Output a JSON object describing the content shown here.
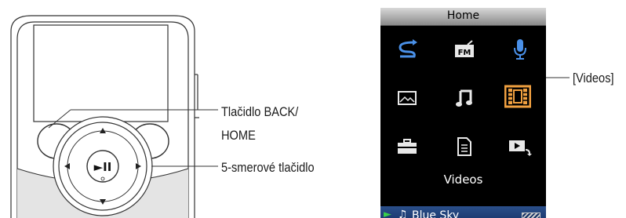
{
  "callouts": {
    "back_home_line1": "Tlačidlo BACK/",
    "back_home_line2": "HOME",
    "five_way": "5-smerové tlačidlo",
    "videos": "[Videos]"
  },
  "player_buttons": {
    "play_pause": "►II"
  },
  "screen": {
    "title": "Home",
    "icons": [
      {
        "name": "shuffle-icon",
        "text": ""
      },
      {
        "name": "fm-radio-icon",
        "text": "FM"
      },
      {
        "name": "microphone-icon",
        "text": ""
      },
      {
        "name": "photo-icon",
        "text": ""
      },
      {
        "name": "music-icon",
        "text": ""
      },
      {
        "name": "video-film-icon",
        "text": ""
      },
      {
        "name": "settings-toolbox-icon",
        "text": ""
      },
      {
        "name": "document-icon",
        "text": ""
      },
      {
        "name": "now-playing-icon",
        "text": ""
      }
    ],
    "selected_label": "Videos",
    "status": {
      "now_playing": "Blue Sky",
      "play_symbol": "►",
      "note_symbol": "♫"
    }
  },
  "colors": {
    "highlight": "#f0a040",
    "status_bar": "#2a4f8a",
    "screen_bg": "#000000"
  }
}
